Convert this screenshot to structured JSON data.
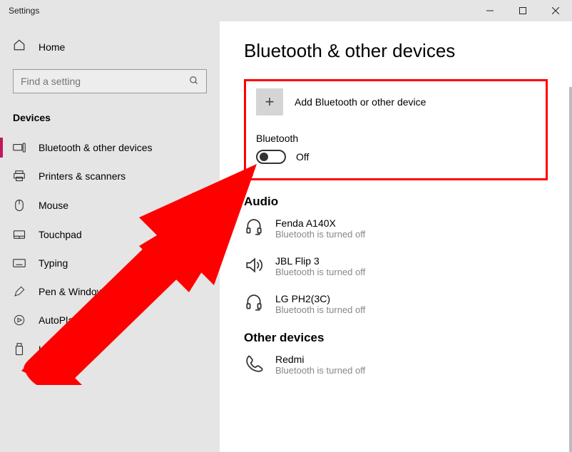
{
  "window": {
    "title": "Settings"
  },
  "sidebar": {
    "home": "Home",
    "search_placeholder": "Find a setting",
    "section": "Devices",
    "items": [
      {
        "label": "Bluetooth & other devices"
      },
      {
        "label": "Printers & scanners"
      },
      {
        "label": "Mouse"
      },
      {
        "label": "Touchpad"
      },
      {
        "label": "Typing"
      },
      {
        "label": "Pen & Windows Ink"
      },
      {
        "label": "AutoPlay"
      },
      {
        "label": "USB"
      }
    ]
  },
  "main": {
    "heading": "Bluetooth & other devices",
    "add_label": "Add Bluetooth or other device",
    "bt_section": "Bluetooth",
    "toggle_state": "Off",
    "audio_heading": "Audio",
    "audio": [
      {
        "name": "Fenda A140X",
        "status": "Bluetooth is turned off"
      },
      {
        "name": "JBL Flip 3",
        "status": "Bluetooth is turned off"
      },
      {
        "name": "LG PH2(3C)",
        "status": "Bluetooth is turned off"
      }
    ],
    "other_heading": "Other devices",
    "other": [
      {
        "name": "Redmi",
        "status": "Bluetooth is turned off"
      }
    ]
  }
}
